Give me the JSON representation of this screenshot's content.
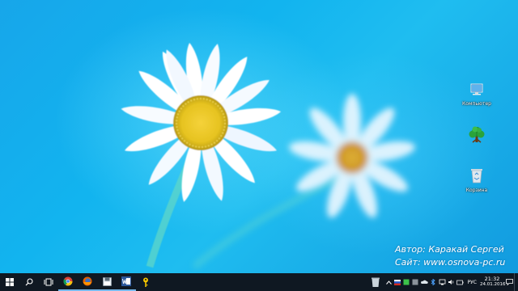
{
  "desktop": {
    "icons": [
      {
        "label": "Компьютер",
        "name": "computer-desktop-icon"
      },
      {
        "label": "",
        "name": "tree-desktop-icon"
      },
      {
        "label": "Корзина",
        "name": "recycle-bin-desktop-icon"
      }
    ],
    "credit": {
      "author": "Автор: Каракай Сергей",
      "site": "Сайт: www.osnova-pc.ru"
    }
  },
  "taskbar": {
    "buttons": [
      {
        "name": "start-button",
        "icon": "windows-logo-icon"
      },
      {
        "name": "search-button",
        "icon": "search-icon"
      },
      {
        "name": "task-view-button",
        "icon": "task-view-icon"
      },
      {
        "name": "chrome-button",
        "icon": "chrome-icon"
      },
      {
        "name": "firefox-button",
        "icon": "firefox-icon"
      },
      {
        "name": "app-button",
        "icon": "floppy-disk-icon"
      },
      {
        "name": "word-button",
        "icon": "word-icon"
      },
      {
        "name": "key-app-button",
        "icon": "key-icon"
      }
    ],
    "tray": {
      "language": "РУС",
      "time": "21:32",
      "date": "24.01.2016"
    }
  },
  "colors": {
    "accent": "#76b9ed",
    "taskbar": "#0f1822",
    "sky": "#17a6ea"
  }
}
